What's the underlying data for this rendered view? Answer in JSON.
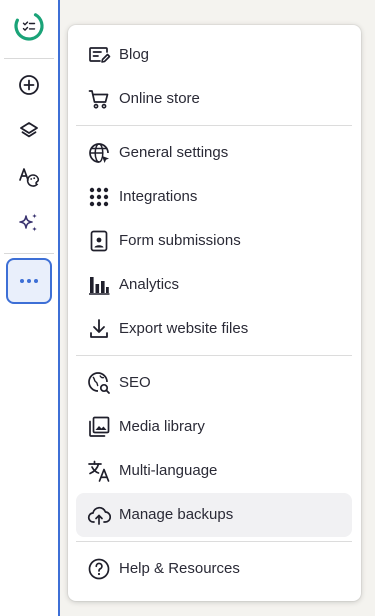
{
  "colors": {
    "accent": "#3d6fd6",
    "logo": "#1aa378",
    "sparkle": "#3a3470",
    "hover_bg": "#f1f1f3"
  },
  "sidebar": {
    "logo_icon": "checklist-circle-icon",
    "buttons": [
      {
        "icon": "plus-circle-icon"
      },
      {
        "icon": "layers-icon"
      },
      {
        "icon": "font-palette-icon"
      },
      {
        "icon": "sparkle-icon"
      },
      {
        "icon": "more-dots-icon",
        "active": true
      }
    ]
  },
  "menu": {
    "groups": [
      [
        {
          "label": "Blog",
          "icon": "blog-edit-icon"
        },
        {
          "label": "Online store",
          "icon": "shopping-cart-icon"
        }
      ],
      [
        {
          "label": "General settings",
          "icon": "globe-cursor-icon"
        },
        {
          "label": "Integrations",
          "icon": "grid-dots-icon"
        },
        {
          "label": "Form submissions",
          "icon": "form-user-icon"
        },
        {
          "label": "Analytics",
          "icon": "bar-chart-icon"
        },
        {
          "label": "Export website files",
          "icon": "download-icon"
        }
      ],
      [
        {
          "label": "SEO",
          "icon": "globe-search-icon"
        },
        {
          "label": "Media library",
          "icon": "image-library-icon"
        },
        {
          "label": "Multi-language",
          "icon": "translate-icon"
        },
        {
          "label": "Manage backups",
          "icon": "cloud-backup-icon",
          "hovered": true
        }
      ],
      [
        {
          "label": "Help & Resources",
          "icon": "help-circle-icon"
        }
      ]
    ]
  }
}
